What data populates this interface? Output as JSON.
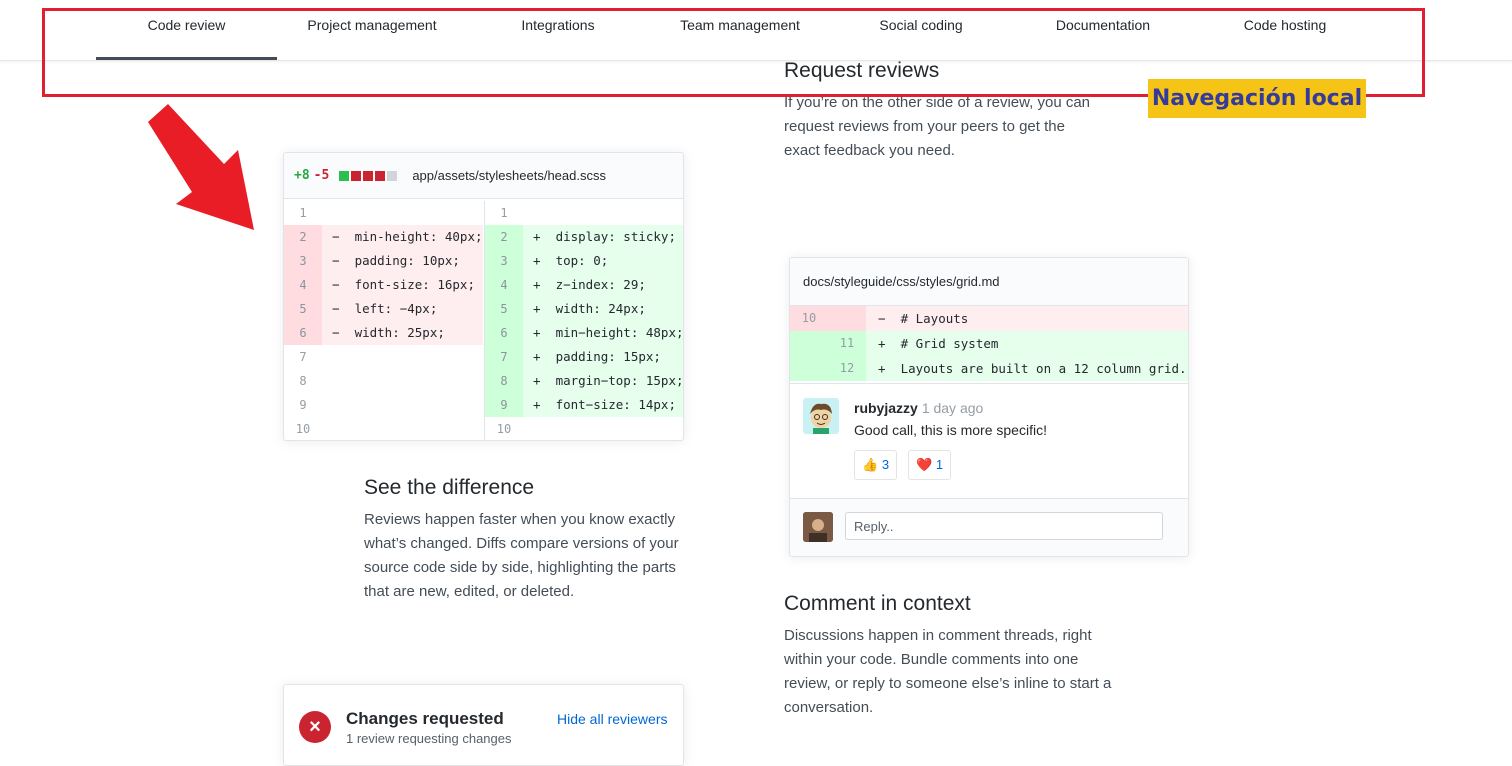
{
  "nav": {
    "tabs": [
      {
        "label": "Code review",
        "active": true
      },
      {
        "label": "Project management"
      },
      {
        "label": "Integrations"
      },
      {
        "label": "Team management"
      },
      {
        "label": "Social coding"
      },
      {
        "label": "Documentation"
      },
      {
        "label": "Code hosting"
      }
    ]
  },
  "annotation": {
    "label": "Navegación local",
    "box_color": "#e02030",
    "label_bg": "#f6c416",
    "label_color": "#343b9a"
  },
  "request_reviews": {
    "title": "Request reviews",
    "body": "If you’re on the other side of a review, you can request reviews from your peers to get the exact feedback you need."
  },
  "see_difference": {
    "title": "See the difference",
    "body": "Reviews happen faster when you know exactly what’s changed. Diffs compare versions of your source code side by side, highlighting the parts that are new, edited, or deleted."
  },
  "comment_context": {
    "title": "Comment in context",
    "body": "Discussions happen in comment threads, right within your code. Bundle comments into one review, or reply to someone else’s inline to start a conversation."
  },
  "diff1": {
    "additions": "+8",
    "deletions": "-5",
    "blocks": [
      "#2cbe4e",
      "#cb2431",
      "#cb2431",
      "#cb2431",
      "#d1d5da"
    ],
    "file": "app/assets/stylesheets/head.scss",
    "left": [
      {
        "num": "1",
        "code": "",
        "type": "ctx"
      },
      {
        "num": "2",
        "code": "−  min-height: 40px;",
        "type": "del"
      },
      {
        "num": "3",
        "code": "−  padding: 10px;",
        "type": "del"
      },
      {
        "num": "4",
        "code": "−  font-size: 16px;",
        "type": "del"
      },
      {
        "num": "5",
        "code": "−  left: −4px;",
        "type": "del"
      },
      {
        "num": "6",
        "code": "−  width: 25px;",
        "type": "del"
      },
      {
        "num": "7",
        "code": "",
        "type": "ctx"
      },
      {
        "num": "8",
        "code": "",
        "type": "ctx"
      },
      {
        "num": "9",
        "code": "",
        "type": "ctx"
      },
      {
        "num": "10",
        "code": "",
        "type": "ctx"
      }
    ],
    "right": [
      {
        "num": "1",
        "code": "",
        "type": "ctx"
      },
      {
        "num": "2",
        "code": "+  display: sticky;",
        "type": "add"
      },
      {
        "num": "3",
        "code": "+  top: 0;",
        "type": "add"
      },
      {
        "num": "4",
        "code": "+  z−index: 29;",
        "type": "add"
      },
      {
        "num": "5",
        "code": "+  width: 24px;",
        "type": "add"
      },
      {
        "num": "6",
        "code": "+  min−height: 48px;",
        "type": "add"
      },
      {
        "num": "7",
        "code": "+  padding: 15px;",
        "type": "add"
      },
      {
        "num": "8",
        "code": "+  margin−top: 15px;",
        "type": "add"
      },
      {
        "num": "9",
        "code": "+  font−size: 14px;",
        "type": "add"
      },
      {
        "num": "10",
        "code": "",
        "type": "ctx"
      }
    ]
  },
  "diff2": {
    "file": "docs/styleguide/css/styles/grid.md",
    "rows": [
      {
        "n1": "10",
        "n2": "",
        "code": "−  # Layouts",
        "type": "del"
      },
      {
        "n1": "",
        "n2": "11",
        "code": "+  # Grid system",
        "type": "add"
      },
      {
        "n1": "",
        "n2": "12",
        "code": "+  Layouts are built on a 12 column grid.",
        "type": "add"
      }
    ],
    "comment": {
      "author": "rubyjazzy",
      "time": "1 day ago",
      "text": "Good call, this is more specific!",
      "reactions": [
        {
          "emoji": "👍",
          "count": "3"
        },
        {
          "emoji": "❤️",
          "count": "1"
        }
      ]
    },
    "reply_placeholder": "Reply.."
  },
  "changes_requested": {
    "title": "Changes requested",
    "subtitle": "1 review requesting changes",
    "hide_link": "Hide all reviewers"
  }
}
